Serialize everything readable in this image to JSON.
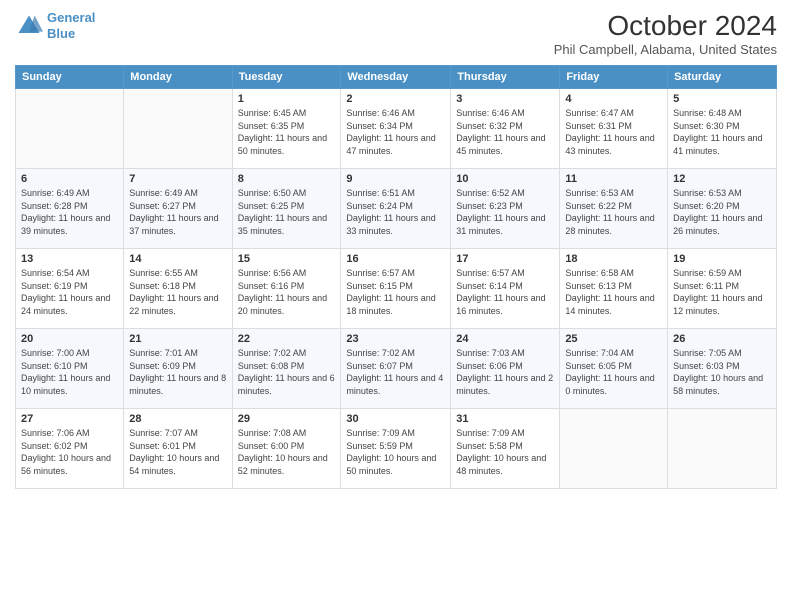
{
  "header": {
    "logo_line1": "General",
    "logo_line2": "Blue",
    "month_title": "October 2024",
    "location": "Phil Campbell, Alabama, United States"
  },
  "weekdays": [
    "Sunday",
    "Monday",
    "Tuesday",
    "Wednesday",
    "Thursday",
    "Friday",
    "Saturday"
  ],
  "weeks": [
    [
      {
        "day": "",
        "info": ""
      },
      {
        "day": "",
        "info": ""
      },
      {
        "day": "1",
        "info": "Sunrise: 6:45 AM\nSunset: 6:35 PM\nDaylight: 11 hours and 50 minutes."
      },
      {
        "day": "2",
        "info": "Sunrise: 6:46 AM\nSunset: 6:34 PM\nDaylight: 11 hours and 47 minutes."
      },
      {
        "day": "3",
        "info": "Sunrise: 6:46 AM\nSunset: 6:32 PM\nDaylight: 11 hours and 45 minutes."
      },
      {
        "day": "4",
        "info": "Sunrise: 6:47 AM\nSunset: 6:31 PM\nDaylight: 11 hours and 43 minutes."
      },
      {
        "day": "5",
        "info": "Sunrise: 6:48 AM\nSunset: 6:30 PM\nDaylight: 11 hours and 41 minutes."
      }
    ],
    [
      {
        "day": "6",
        "info": "Sunrise: 6:49 AM\nSunset: 6:28 PM\nDaylight: 11 hours and 39 minutes."
      },
      {
        "day": "7",
        "info": "Sunrise: 6:49 AM\nSunset: 6:27 PM\nDaylight: 11 hours and 37 minutes."
      },
      {
        "day": "8",
        "info": "Sunrise: 6:50 AM\nSunset: 6:25 PM\nDaylight: 11 hours and 35 minutes."
      },
      {
        "day": "9",
        "info": "Sunrise: 6:51 AM\nSunset: 6:24 PM\nDaylight: 11 hours and 33 minutes."
      },
      {
        "day": "10",
        "info": "Sunrise: 6:52 AM\nSunset: 6:23 PM\nDaylight: 11 hours and 31 minutes."
      },
      {
        "day": "11",
        "info": "Sunrise: 6:53 AM\nSunset: 6:22 PM\nDaylight: 11 hours and 28 minutes."
      },
      {
        "day": "12",
        "info": "Sunrise: 6:53 AM\nSunset: 6:20 PM\nDaylight: 11 hours and 26 minutes."
      }
    ],
    [
      {
        "day": "13",
        "info": "Sunrise: 6:54 AM\nSunset: 6:19 PM\nDaylight: 11 hours and 24 minutes."
      },
      {
        "day": "14",
        "info": "Sunrise: 6:55 AM\nSunset: 6:18 PM\nDaylight: 11 hours and 22 minutes."
      },
      {
        "day": "15",
        "info": "Sunrise: 6:56 AM\nSunset: 6:16 PM\nDaylight: 11 hours and 20 minutes."
      },
      {
        "day": "16",
        "info": "Sunrise: 6:57 AM\nSunset: 6:15 PM\nDaylight: 11 hours and 18 minutes."
      },
      {
        "day": "17",
        "info": "Sunrise: 6:57 AM\nSunset: 6:14 PM\nDaylight: 11 hours and 16 minutes."
      },
      {
        "day": "18",
        "info": "Sunrise: 6:58 AM\nSunset: 6:13 PM\nDaylight: 11 hours and 14 minutes."
      },
      {
        "day": "19",
        "info": "Sunrise: 6:59 AM\nSunset: 6:11 PM\nDaylight: 11 hours and 12 minutes."
      }
    ],
    [
      {
        "day": "20",
        "info": "Sunrise: 7:00 AM\nSunset: 6:10 PM\nDaylight: 11 hours and 10 minutes."
      },
      {
        "day": "21",
        "info": "Sunrise: 7:01 AM\nSunset: 6:09 PM\nDaylight: 11 hours and 8 minutes."
      },
      {
        "day": "22",
        "info": "Sunrise: 7:02 AM\nSunset: 6:08 PM\nDaylight: 11 hours and 6 minutes."
      },
      {
        "day": "23",
        "info": "Sunrise: 7:02 AM\nSunset: 6:07 PM\nDaylight: 11 hours and 4 minutes."
      },
      {
        "day": "24",
        "info": "Sunrise: 7:03 AM\nSunset: 6:06 PM\nDaylight: 11 hours and 2 minutes."
      },
      {
        "day": "25",
        "info": "Sunrise: 7:04 AM\nSunset: 6:05 PM\nDaylight: 11 hours and 0 minutes."
      },
      {
        "day": "26",
        "info": "Sunrise: 7:05 AM\nSunset: 6:03 PM\nDaylight: 10 hours and 58 minutes."
      }
    ],
    [
      {
        "day": "27",
        "info": "Sunrise: 7:06 AM\nSunset: 6:02 PM\nDaylight: 10 hours and 56 minutes."
      },
      {
        "day": "28",
        "info": "Sunrise: 7:07 AM\nSunset: 6:01 PM\nDaylight: 10 hours and 54 minutes."
      },
      {
        "day": "29",
        "info": "Sunrise: 7:08 AM\nSunset: 6:00 PM\nDaylight: 10 hours and 52 minutes."
      },
      {
        "day": "30",
        "info": "Sunrise: 7:09 AM\nSunset: 5:59 PM\nDaylight: 10 hours and 50 minutes."
      },
      {
        "day": "31",
        "info": "Sunrise: 7:09 AM\nSunset: 5:58 PM\nDaylight: 10 hours and 48 minutes."
      },
      {
        "day": "",
        "info": ""
      },
      {
        "day": "",
        "info": ""
      }
    ]
  ]
}
